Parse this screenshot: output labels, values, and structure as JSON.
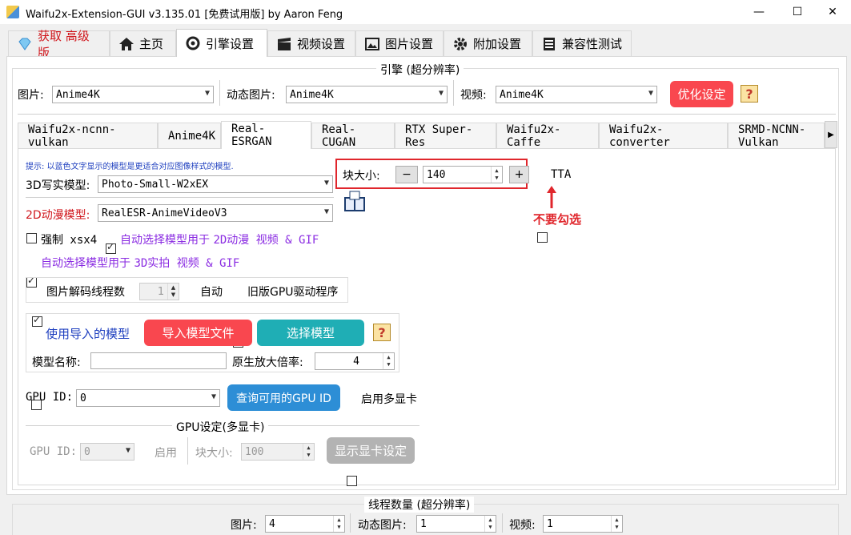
{
  "window": {
    "title": "Waifu2x-Extension-GUI v3.135.01 [免费试用版] by Aaron Feng",
    "min": "—",
    "max": "☐",
    "close": "✕"
  },
  "tabs": [
    {
      "label": "获取 高级版"
    },
    {
      "label": "主页"
    },
    {
      "label": "引擎设置"
    },
    {
      "label": "视频设置"
    },
    {
      "label": "图片设置"
    },
    {
      "label": "附加设置"
    },
    {
      "label": "兼容性测试"
    }
  ],
  "engine_group": {
    "title": "引擎 (超分辨率)",
    "image_label": "图片:",
    "image_value": "Anime4K",
    "gif_label": "动态图片:",
    "gif_value": "Anime4K",
    "video_label": "视频:",
    "video_value": "Anime4K",
    "optimize_button": "优化设定",
    "help": "?"
  },
  "engine_tabs": [
    {
      "label": "Waifu2x-ncnn-vulkan"
    },
    {
      "label": "Anime4K"
    },
    {
      "label": "Real-ESRGAN"
    },
    {
      "label": "Real-CUGAN"
    },
    {
      "label": "RTX Super-Res"
    },
    {
      "label": "Waifu2x-Caffe"
    },
    {
      "label": "Waifu2x-converter"
    },
    {
      "label": "SRMD-NCNN-Vulkan"
    }
  ],
  "esrgan": {
    "hint": "提示: 以蓝色文字显示的模型是更适合对应图像样式的模型.",
    "model_3d_label": "3D写实模型:",
    "model_3d_value": "Photo-Small-W2xEX",
    "model_2d_label": "2D动漫模型:",
    "model_2d_value": "RealESR-AnimeVideoV3",
    "force_xsx4": "强制 xsx4",
    "auto_2d_prefix": "自动选择模型用于 ",
    "auto_2d_suffix": "2D动漫 视频 & GIF",
    "auto_3d_prefix": "自动选择模型用于 ",
    "auto_3d_suffix": "3D实拍 视频 & GIF",
    "decode_threads_label": "图片解码线程数",
    "decode_threads_value": "1",
    "auto_label": "自动",
    "legacy_gpu_label": "旧版GPU驱动程序",
    "tile_label": "块大小:",
    "tile_minus": "−",
    "tile_value": "140",
    "tile_plus": "+",
    "tta_label": "TTA",
    "annotation": "不要勾选",
    "custom_model_label": "使用导入的模型",
    "import_model_button": "导入模型文件",
    "select_model_button": "选择模型",
    "model_name_label": "模型名称:",
    "model_name_value": "",
    "native_scale_label": "原生放大倍率:",
    "native_scale_value": "4",
    "gpu_id_label": "GPU ID:",
    "gpu_id_value": "0",
    "query_gpu_button": "查询可用的GPU ID",
    "multi_gpu_label": "启用多显卡",
    "gpu_settings_title": "GPU设定(多显卡)",
    "gpu_id2_label": "GPU ID:",
    "gpu_id2_value": "0",
    "enable_label": "启用",
    "tile2_label": "块大小:",
    "tile2_value": "100",
    "show_gpu_button": "显示显卡设定"
  },
  "threads_group": {
    "title": "线程数量 (超分辨率)",
    "image_label": "图片:",
    "image_value": "4",
    "gif_label": "动态图片:",
    "gif_value": "1",
    "video_label": "视频:",
    "video_value": "1"
  },
  "colors": {
    "accent_red": "#f9474f",
    "accent_blue": "#2d8ed6",
    "hint_blue": "#1e3fbf",
    "purple": "#8a2be2",
    "red_label": "#d0161c"
  }
}
